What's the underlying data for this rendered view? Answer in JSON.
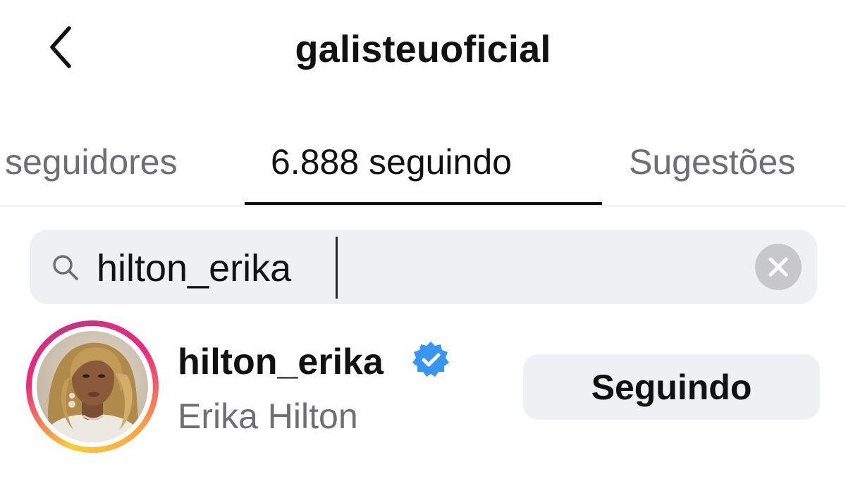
{
  "header": {
    "title": "galisteuoficial",
    "back_icon": "chevron-left-icon"
  },
  "tabs": [
    {
      "label": "seguidores",
      "active": false
    },
    {
      "label": "6.888 seguindo",
      "active": true
    },
    {
      "label": "Sugestões",
      "active": false
    }
  ],
  "search": {
    "value": "hilton_erika",
    "icon": "search-icon",
    "clear_icon": "clear-icon"
  },
  "results": [
    {
      "username": "hilton_erika",
      "full_name": "Erika Hilton",
      "verified": true,
      "has_story": true,
      "button_label": "Seguindo"
    }
  ],
  "colors": {
    "text_primary": "#111111",
    "text_secondary": "#6e6e73",
    "surface": "#eff0f4",
    "verified_blue": "#3797f0"
  }
}
